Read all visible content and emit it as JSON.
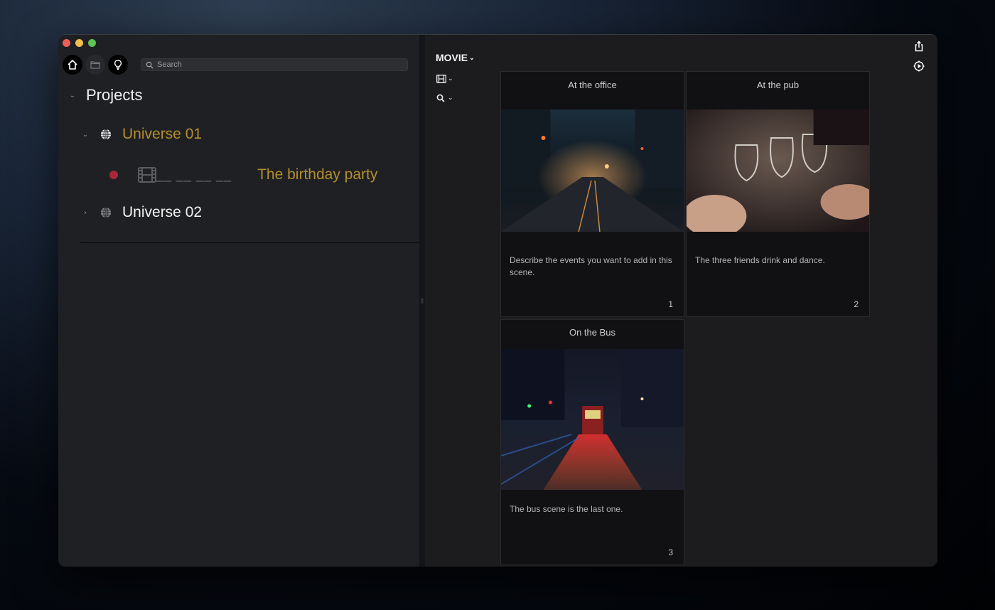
{
  "window": {
    "traffic_lights": [
      "close",
      "minimize",
      "zoom"
    ]
  },
  "sidebar": {
    "nav_buttons": [
      {
        "icon": "home-icon",
        "active": true
      },
      {
        "icon": "folder-icon",
        "active": false
      },
      {
        "icon": "lightbulb-icon",
        "active": true
      }
    ],
    "search": {
      "placeholder": "Search",
      "value": ""
    },
    "projects_label": "Projects",
    "universes": [
      {
        "label": "Universe 01",
        "expanded": true,
        "color": "#b58e2c",
        "scenes": [
          {
            "status_color": "#a8283a",
            "placeholder": "__ __ __ __",
            "title": "The birthday party"
          }
        ]
      },
      {
        "label": "Universe 02",
        "expanded": false,
        "color": "#f2f2f2"
      }
    ]
  },
  "main": {
    "title": "MOVIE",
    "tools": [
      {
        "icon": "film-icon"
      },
      {
        "icon": "search-icon"
      }
    ],
    "cards": [
      {
        "title": "At the office",
        "description": "Describe the events you want to add in this scene.",
        "number": "1",
        "image": "night city street"
      },
      {
        "title": "At the pub",
        "description": "The three friends drink and dance.",
        "number": "2",
        "image": "friends toasting wine glasses"
      },
      {
        "title": "On the Bus",
        "description": "The bus scene is the last one.",
        "number": "3",
        "image": "tram on rainy night street"
      }
    ],
    "right_icons": [
      "share-icon",
      "play-settings-icon"
    ]
  },
  "colors": {
    "accent": "#b58e2c",
    "status_red": "#a8283a"
  }
}
